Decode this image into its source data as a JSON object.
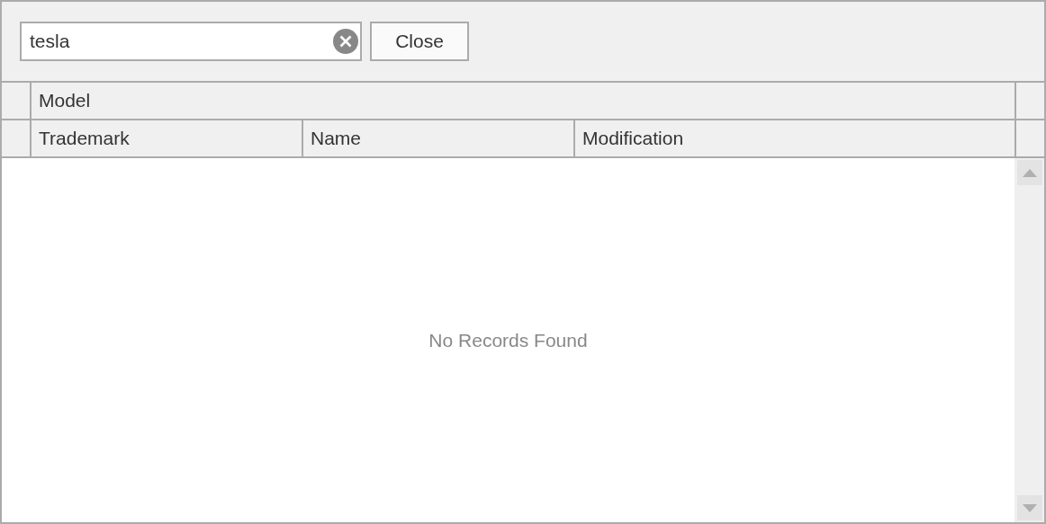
{
  "search": {
    "value": "tesla"
  },
  "buttons": [
    "Close"
  ],
  "table": {
    "band": "Model",
    "columns": [
      "Trademark",
      "Name",
      "Modification"
    ],
    "empty_text": "No Records Found"
  }
}
